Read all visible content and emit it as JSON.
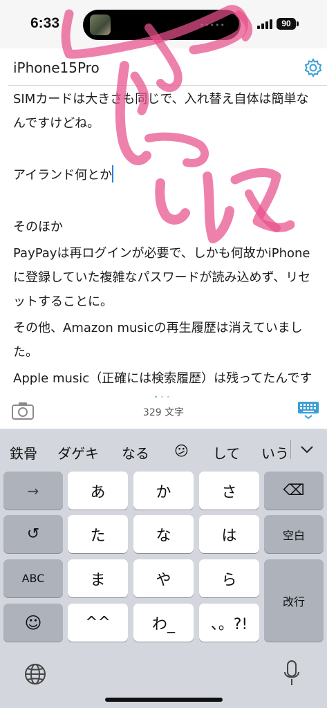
{
  "status": {
    "time": "6:33",
    "battery": "90",
    "island_dots": "•••••"
  },
  "document": {
    "title": "iPhone15Pro",
    "lines": [
      "SIMカードは大きさも同じで、入れ替え自体は簡単なんですけどね。",
      "アイランド何とか",
      "そのほか",
      "PayPayは再ログインが必要で、しかも何故かiPhoneに登録していた複雑なパスワードが読み込めず、リセットすることに。",
      "その他、Amazon musicの再生履歴は消えていました。",
      "Apple music（正確には検索履歴）は残ってたんですけどね。"
    ]
  },
  "toolbar": {
    "char_count": "329 文字",
    "page_dots": [
      "•",
      "•",
      "•"
    ],
    "icons": [
      "camera-icon",
      "keyboard-toggle-icon",
      "gear-icon"
    ]
  },
  "keyboard": {
    "candidates": [
      "鉄骨",
      "ダゲキ",
      "なる",
      "😕",
      "して",
      "いう"
    ],
    "rows": [
      [
        "→",
        "あ",
        "か",
        "さ",
        "⌫"
      ],
      [
        "↺",
        "た",
        "な",
        "は",
        "空白"
      ],
      [
        "ABC",
        "ま",
        "や",
        "ら",
        "改行"
      ],
      [
        "☺",
        "^^",
        "わ_",
        "、。?!"
      ]
    ]
  },
  "colors": {
    "accent": "#2a7fd4",
    "scribble": "#e8508a",
    "keyboard_bg": "#d3d6dc"
  }
}
